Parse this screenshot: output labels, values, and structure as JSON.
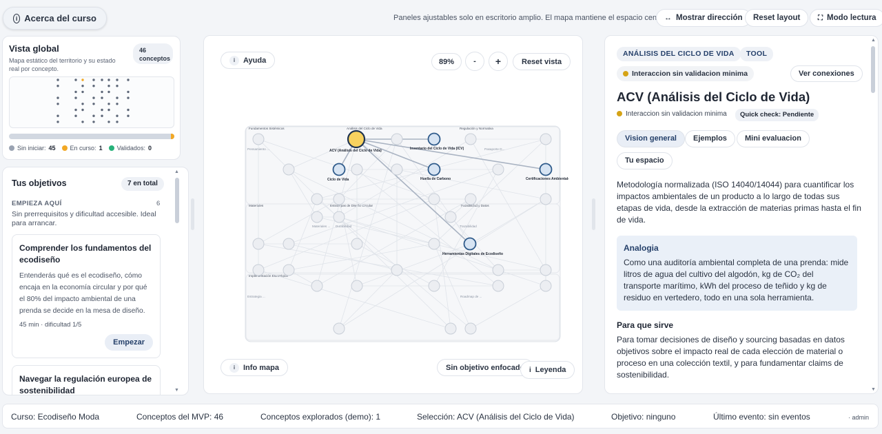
{
  "topbar": {
    "about_label": "Acerca del curso",
    "note": "Paneles ajustables solo en escritorio amplio. El mapa mantiene el espacio central.",
    "show_direction": "Mostrar dirección",
    "reset_layout": "Reset layout",
    "reading_mode": "Modo lectura"
  },
  "vista": {
    "title": "Vista global",
    "subtitle": "Mapa estático del territorio y su estado real por concepto.",
    "count": "46",
    "count_label": "conceptos",
    "progress_validated_fraction": 0.022,
    "legend": {
      "no_start_label": "Sin iniciar:",
      "no_start_value": "45",
      "in_course_label": "En curso:",
      "in_course_value": "1",
      "validated_label": "Validados:",
      "validated_value": "0",
      "colors": {
        "no_start": "#9aa3b2",
        "in_course": "#f2a825",
        "validated": "#27b27a"
      }
    }
  },
  "objetivos": {
    "title": "Tus objetivos",
    "total": "7 en total",
    "section_label": "EMPIEZA AQUÍ",
    "section_count": "6",
    "section_desc": "Sin prerrequisitos y dificultad accesible. Ideal para arrancar.",
    "cards": [
      {
        "title": "Comprender los fundamentos del ecodiseño",
        "desc": "Entenderás qué es el ecodiseño, cómo encaja en la economía circular y por qué el 80% del impacto ambiental de una prenda se decide en la mesa de diseño.",
        "meta": "45 min · dificultad 1/5",
        "action": "Empezar"
      },
      {
        "title": "Navegar la regulación europea de sostenibilidad"
      }
    ]
  },
  "map": {
    "help": "Ayuda",
    "zoom": "89%",
    "zoom_out": "-",
    "zoom_in": "+",
    "reset_view": "Reset vista",
    "info": "Info mapa",
    "no_objective": "Sin objetivo enfocado",
    "legend": "Leyenda",
    "info_icon_glyph": "i",
    "regions": [
      {
        "label": "Fundamentos Sistémicos"
      },
      {
        "label": "Análisis del Ciclo de Vida"
      },
      {
        "label": "Regulación y Normativa"
      },
      {
        "label": "Materiales"
      },
      {
        "label": "Estrategias de Diseño Circular"
      },
      {
        "label": "Trazabilidad y Datos"
      },
      {
        "label": "Implementación Estratégica"
      }
    ],
    "node_labels": {
      "acv": "ACV (Análisis del Ciclo de Vida)",
      "ciclo": "Ciclo de Vida",
      "inventario": "Inventario del Ciclo de Vida (ICV)",
      "huella": "Huella de Carbono",
      "certif": "Certificaciones Ambientales",
      "herram": "Herramientas Digitales de Ecodiseño",
      "pensamiento": "Pensamiento ...",
      "pasaporte": "Pasaporte D...",
      "materiales": "Materiales ...",
      "durabilidad": "Durabilidad",
      "trazabilidad": "Trazabilidad",
      "estrategia": "Estrategia ...",
      "roadmap": "Roadmap de ..."
    }
  },
  "detail": {
    "tag_main": "ANÁLISIS DEL CICLO DE VIDA",
    "tag_type": "TOOL",
    "status": "Interaccion sin validacion minima",
    "connections": "Ver conexiones",
    "title": "ACV (Análisis del Ciclo de Vida)",
    "status_line": "Interaccion sin validacion minima",
    "quick_check": "Quick check: Pendiente",
    "tabs": [
      "Vision general",
      "Ejemplos",
      "Mini evaluacion",
      "Tu espacio"
    ],
    "description": "Metodología normalizada (ISO 14040/14044) para cuantificar los impactos ambientales de un producto a lo largo de todas sus etapas de vida, desde la extracción de materias primas hasta el fin de vida.",
    "analogy_title": "Analogia",
    "analogy": "Como una auditoría ambiental completa de una prenda: mide litros de agua del cultivo del algodón, kg de CO₂ del transporte marítimo, kWh del proceso de teñido y kg de residuo en vertedero, todo en una sola herramienta.",
    "purpose_title": "Para que sirve",
    "purpose": "Para tomar decisiones de diseño y sourcing basadas en datos objetivos sobre el impacto real de cada elección de material o proceso en una colección textil, y para fundamentar claims de sostenibilidad."
  },
  "footer": {
    "course": "Curso: Ecodiseño Moda",
    "concepts": "Conceptos del MVP: 46",
    "explored": "Conceptos explorados (demo): 1",
    "selection": "Selección: ACV (Análisis del Ciclo de Vida)",
    "objective": "Objetivo: ninguno",
    "last_event": "Último evento: sin eventos",
    "user": "· admin"
  }
}
